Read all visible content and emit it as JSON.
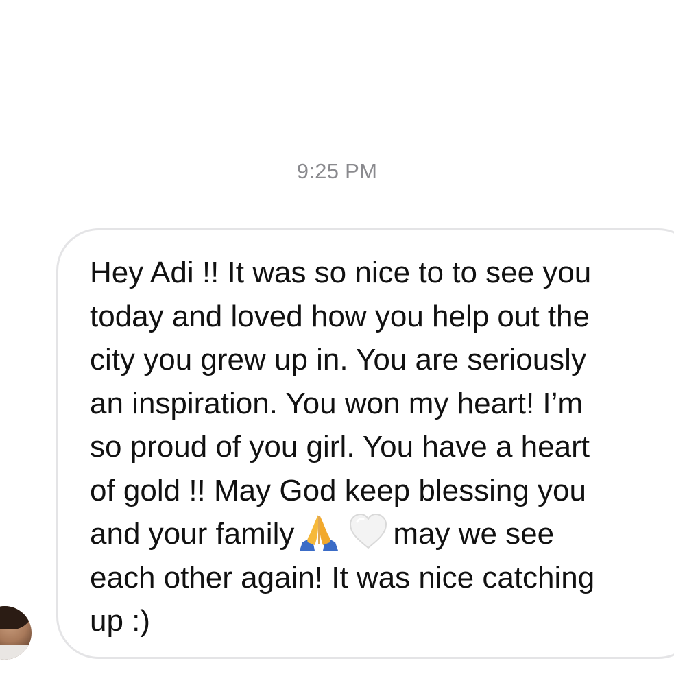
{
  "thread": {
    "timestamp": "9:25 PM"
  },
  "message": {
    "lines": {
      "0": "Hey Adi !! It was so nice to to see you",
      "1": "today and loved how you help out the",
      "2": "city you grew up in. You are seriously",
      "3": "an inspiration. You won my heart! I’m",
      "4": "so proud of you girl. You have a heart",
      "5": "of gold !! May God keep blessing you",
      "6a": "and your family",
      "6b": "may we see",
      "7": "each other again! It was nice catching",
      "8": "up :)"
    },
    "emojis": [
      "folded-hands-icon",
      "white-heart-icon"
    ]
  },
  "sender": {
    "avatar": "avatar"
  },
  "colors": {
    "background": "#ffffff",
    "bubble_border": "#e4e4e6",
    "timestamp_text": "#8a8a8e",
    "message_text": "#111111"
  }
}
